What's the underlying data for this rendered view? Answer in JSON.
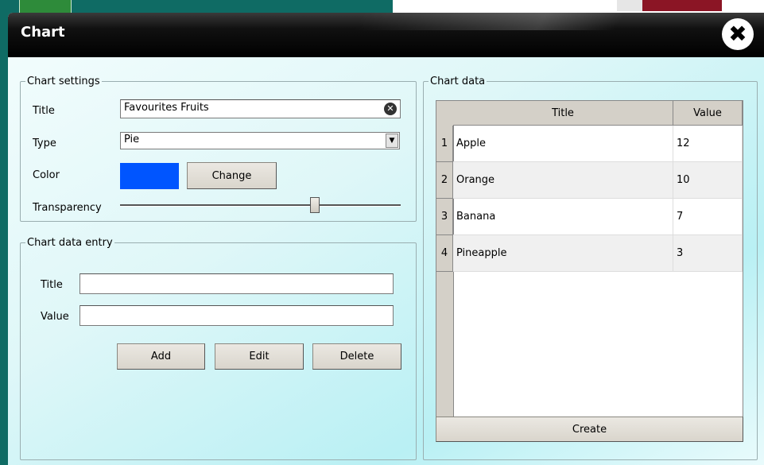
{
  "dialog": {
    "title": "Chart",
    "close_glyph": "✖"
  },
  "chart_settings": {
    "legend": "Chart settings",
    "title_label": "Title",
    "title_value": "Favourites Fruits",
    "type_label": "Type",
    "type_value": "Pie",
    "color_label": "Color",
    "color_value": "#0055ff",
    "change_button": "Change",
    "transparency_label": "Transparency",
    "transparency_fraction": 0.7
  },
  "chart_data_entry": {
    "legend": "Chart data entry",
    "title_label": "Title",
    "title_value": "",
    "value_label": "Value",
    "value_value": "",
    "add_button": "Add",
    "edit_button": "Edit",
    "delete_button": "Delete"
  },
  "chart_data": {
    "legend": "Chart data",
    "columns": [
      "Title",
      "Value"
    ],
    "rows": [
      {
        "num": "1",
        "title": "Apple",
        "value": "12"
      },
      {
        "num": "2",
        "title": "Orange",
        "value": "10"
      },
      {
        "num": "3",
        "title": "Banana",
        "value": "7"
      },
      {
        "num": "4",
        "title": "Pineapple",
        "value": "3"
      }
    ],
    "create_button": "Create"
  },
  "icons": {
    "clear": "clear-icon",
    "close": "close-icon",
    "dropdown": "chevron-down-icon"
  }
}
